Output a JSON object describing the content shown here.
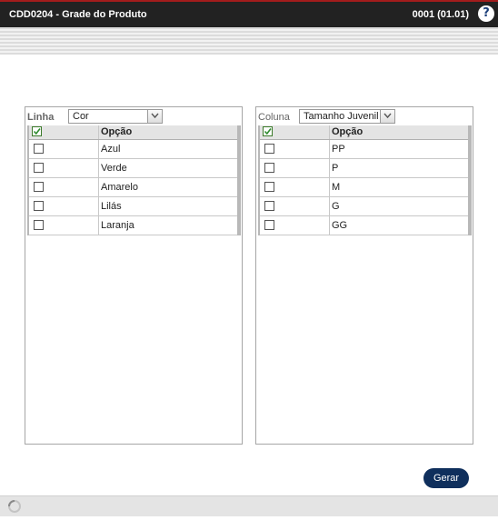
{
  "header": {
    "title": "CDD0204 - Grade do Produto",
    "code": "0001 (01.01)",
    "help_icon": "question-icon",
    "help_symbol": "?",
    "accent_color": "#a31c1c",
    "bar_color": "#222222"
  },
  "left_panel": {
    "label": "Linha",
    "selected": "Cor",
    "column_header": "Opção",
    "rows": [
      {
        "label": "Azul",
        "checked": false
      },
      {
        "label": "Verde",
        "checked": false
      },
      {
        "label": "Amarelo",
        "checked": false
      },
      {
        "label": "Lilás",
        "checked": false
      },
      {
        "label": "Laranja",
        "checked": false
      }
    ],
    "header_checked": true
  },
  "right_panel": {
    "label": "Coluna",
    "selected": "Tamanho Juvenil",
    "column_header": "Opção",
    "rows": [
      {
        "label": "PP",
        "checked": false
      },
      {
        "label": "P",
        "checked": false
      },
      {
        "label": "M",
        "checked": false
      },
      {
        "label": "G",
        "checked": false
      },
      {
        "label": "GG",
        "checked": false
      }
    ],
    "header_checked": true
  },
  "actions": {
    "generate_label": "Gerar",
    "button_color": "#0f2f5c"
  },
  "status": {
    "spinner_icon": "loading-spinner-icon"
  }
}
